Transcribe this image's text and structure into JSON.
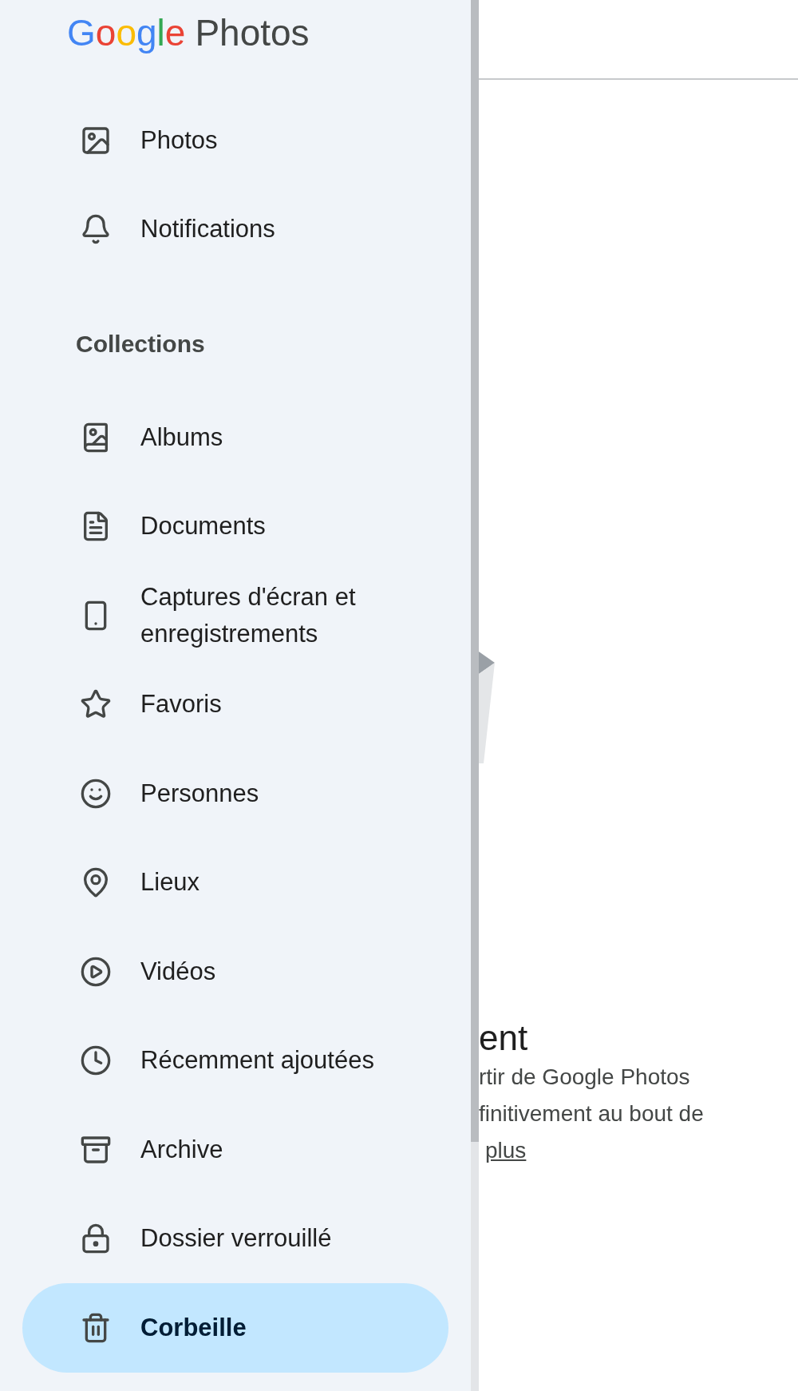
{
  "drawer": {
    "logo": {
      "brand": "Google",
      "product": "Photos"
    },
    "items": [
      {
        "label": "Photos",
        "selected": false
      },
      {
        "label": "Notifications",
        "selected": false
      }
    ],
    "section": {
      "title": "Collections",
      "items": [
        {
          "label": "Albums",
          "selected": false
        },
        {
          "label": "Documents",
          "selected": false
        },
        {
          "label": "Captures d'écran et enregistrements",
          "selected": false
        },
        {
          "label": "Favoris",
          "selected": false
        },
        {
          "label": "Personnes",
          "selected": false
        },
        {
          "label": "Lieux",
          "selected": false
        },
        {
          "label": "Vidéos",
          "selected": false
        },
        {
          "label": "Récemment ajoutées",
          "selected": false
        },
        {
          "label": "Archive",
          "selected": false
        },
        {
          "label": "Dossier verrouillé",
          "selected": false
        },
        {
          "label": "Corbeille",
          "selected": true
        }
      ]
    }
  },
  "main": {
    "heading": "ent",
    "lines": [
      "rtir de Google Photos",
      "finitivement au bout de"
    ],
    "link": "plus"
  }
}
